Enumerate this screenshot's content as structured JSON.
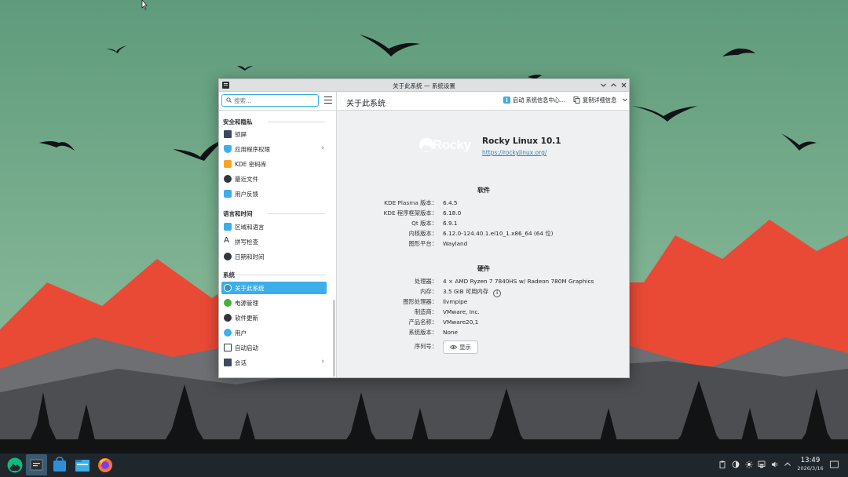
{
  "window": {
    "title": "关于此系统 — 系统设置"
  },
  "search": {
    "placeholder": "搜索..."
  },
  "sidebar": {
    "sections": [
      {
        "label": "安全和隐私",
        "items": [
          {
            "label": "锁屏",
            "icon": "lock-screen-icon"
          },
          {
            "label": "应用程序权限",
            "icon": "shield-icon",
            "has_arrow": true
          },
          {
            "label": "KDE 密码库",
            "icon": "wallet-icon"
          },
          {
            "label": "最近文件",
            "icon": "recent-files-icon"
          },
          {
            "label": "用户反馈",
            "icon": "feedback-icon"
          }
        ]
      },
      {
        "label": "语言和时间",
        "items": [
          {
            "label": "区域和语言",
            "icon": "region-icon"
          },
          {
            "label": "拼写检查",
            "icon": "spellcheck-icon"
          },
          {
            "label": "日期和时间",
            "icon": "clock-icon"
          }
        ]
      },
      {
        "label": "系统",
        "items": [
          {
            "label": "关于此系统",
            "icon": "info-icon",
            "selected": true
          },
          {
            "label": "电源管理",
            "icon": "power-icon"
          },
          {
            "label": "软件更新",
            "icon": "update-icon"
          },
          {
            "label": "用户",
            "icon": "user-icon"
          },
          {
            "label": "自动启动",
            "icon": "autostart-icon"
          },
          {
            "label": "会话",
            "icon": "session-icon",
            "has_arrow": true
          }
        ]
      }
    ]
  },
  "main": {
    "title": "关于此系统",
    "launch_info_label": "启动 系统信息中心...",
    "copy_details_label": "复制详细信息",
    "logo_text": "Rocky",
    "distro_name": "Rocky Linux 10.1",
    "distro_url": "https://rockylinux.org/",
    "software": {
      "title": "软件",
      "rows": [
        {
          "key": "KDE Plasma 版本：",
          "value": "6.4.5"
        },
        {
          "key": "KDE 程序框架版本：",
          "value": "6.18.0"
        },
        {
          "key": "Qt 版本：",
          "value": "6.9.1"
        },
        {
          "key": "内核版本：",
          "value": "6.12.0-124.40.1.el10_1.x86_64 (64 位)"
        },
        {
          "key": "图形平台：",
          "value": "Wayland"
        }
      ]
    },
    "hardware": {
      "title": "硬件",
      "rows": [
        {
          "key": "处理器：",
          "value": "4 × AMD Ryzen 7 7840HS w/ Radeon 780M Graphics"
        },
        {
          "key": "内存：",
          "value": "3.5 GiB 可用内存"
        },
        {
          "key": "图形处理器：",
          "value": "llvmpipe"
        },
        {
          "key": "制造商：",
          "value": "VMware, Inc."
        },
        {
          "key": "产品名称：",
          "value": "VMware20,1"
        },
        {
          "key": "系统版本：",
          "value": "None"
        },
        {
          "key": "序列号：",
          "value": ""
        }
      ],
      "show_button": "显示"
    }
  },
  "taskbar": {
    "time": "13:49",
    "date": "2026/3/16"
  },
  "colors": {
    "accent": "#3daee9",
    "sky": "#6fa789",
    "mountain_red": "#e84a35",
    "taskbar": "#20272c"
  }
}
